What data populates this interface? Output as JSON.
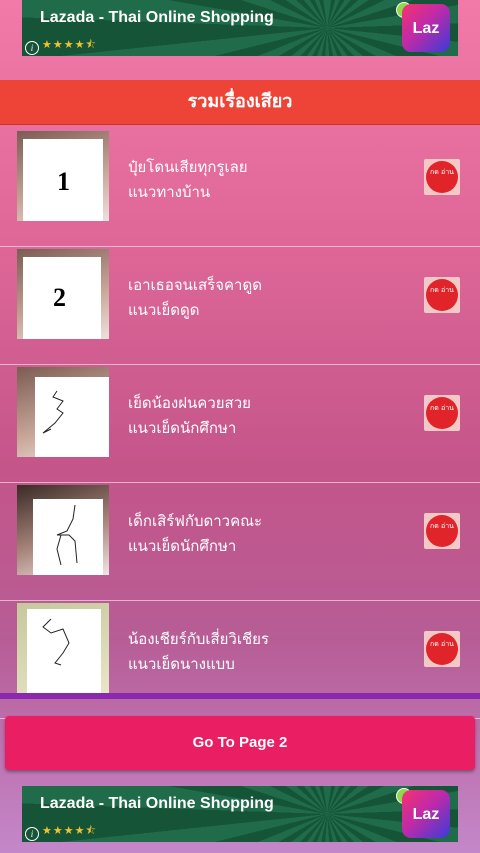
{
  "ad": {
    "title": "Lazada - Thai Online Shopping",
    "rating_stars": "★★★★⯪",
    "info": "i",
    "logo_text": "Laz"
  },
  "header": {
    "title": "รวมเรื่องเสียว"
  },
  "stories": [
    {
      "number": "1",
      "title": "ปุ๋ยโดนเสียทุกรูเลย",
      "category": "แนวทางบ้าน",
      "read_label": "กด อ่าน"
    },
    {
      "number": "2",
      "title": "เอาเธอจนเสร็จคาดูด",
      "category": "แนวเย็ดดูด",
      "read_label": "กด อ่าน"
    },
    {
      "number": "",
      "title": "เย็ดน้องฝนควยสวย",
      "category": "แนวเย็ดนักศึกษา",
      "read_label": "กด อ่าน"
    },
    {
      "number": "",
      "title": "เด็กเสิร์ฟกับดาวคณะ",
      "category": "แนวเย็ดนักศึกษา",
      "read_label": "กด อ่าน"
    },
    {
      "number": "",
      "title": "น้องเชียร์กับเสี่ยวิเชียร",
      "category": "แนวเย็ดนางแบบ",
      "read_label": "กด อ่าน"
    }
  ],
  "pagination": {
    "next_label": "Go To Page 2"
  },
  "colors": {
    "header": "#ee4437",
    "button": "#e91e63",
    "divider": "#8b28b0"
  }
}
